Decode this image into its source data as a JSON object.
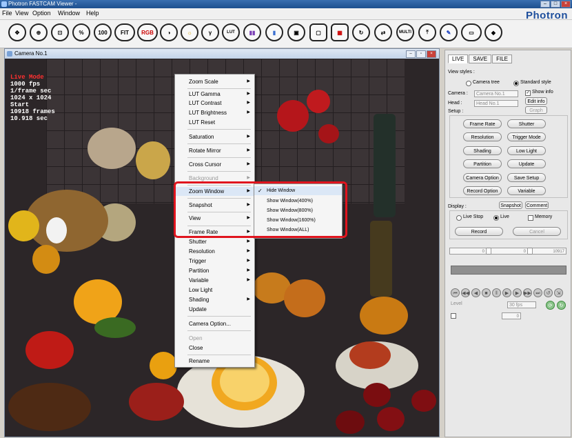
{
  "window": {
    "title": "Photron FASTCAM Viewer -"
  },
  "menubar": [
    "File",
    "View",
    "Option",
    "Window",
    "Help"
  ],
  "brand": "Photron",
  "toolbar": {
    "buttons": [
      {
        "name": "move-icon",
        "label": "✥"
      },
      {
        "name": "zoom-in-icon",
        "label": "⊕"
      },
      {
        "name": "crop-icon",
        "label": "⊡"
      },
      {
        "name": "percent-icon",
        "label": "%"
      },
      {
        "name": "zoom-100-icon",
        "label": "100"
      },
      {
        "name": "fit-icon",
        "label": "FIT"
      },
      {
        "name": "rgb-icon",
        "label": "RGB"
      },
      {
        "name": "contrast-icon",
        "label": "◑"
      },
      {
        "name": "brightness-icon",
        "label": "☼"
      },
      {
        "name": "gamma-icon",
        "label": "γ"
      },
      {
        "name": "lut-reset-icon",
        "label": "LUT"
      },
      {
        "name": "color-bars-icon",
        "label": "▮▮"
      },
      {
        "name": "color-reset-icon",
        "label": "▮"
      },
      {
        "name": "mask-icon",
        "label": "▣"
      },
      {
        "name": "window-icon",
        "label": "▢"
      },
      {
        "name": "grid-icon",
        "label": "▦"
      },
      {
        "name": "refresh-icon",
        "label": "↻"
      },
      {
        "name": "sync-icon",
        "label": "⇄"
      },
      {
        "name": "multi-lock-icon",
        "label": "MULTI"
      },
      {
        "name": "cursor-icon",
        "label": "⤒"
      },
      {
        "name": "pen-icon",
        "label": "✎"
      },
      {
        "name": "display-icon",
        "label": "▭"
      },
      {
        "name": "eraser-icon",
        "label": "◆"
      }
    ]
  },
  "camera": {
    "title": "Camera No.1",
    "info": {
      "mode": "Live Mode",
      "fps": "1000 fps",
      "shutter": "1/frame sec",
      "resolution": "1024 x 1024",
      "start": "Start",
      "frames": "10918 frames",
      "sec": "10.918 sec"
    }
  },
  "context_menu": {
    "items": [
      {
        "label": "Zoom Scale",
        "arrow": true
      },
      {
        "label": "LUT Gamma",
        "arrow": true
      },
      {
        "label": "LUT Contrast",
        "arrow": true
      },
      {
        "label": "LUT Brightness",
        "arrow": true
      },
      {
        "label": "LUT Reset",
        "arrow": false
      },
      {
        "label": "Saturation",
        "arrow": true
      },
      {
        "label": "Rotate Mirror",
        "arrow": true
      },
      {
        "label": "Cross Cursor",
        "arrow": true
      },
      {
        "label": "Background",
        "arrow": true,
        "disabled": true
      },
      {
        "label": "Zoom Window",
        "arrow": true,
        "highlighted": true
      },
      {
        "label": "Snapshot",
        "arrow": true
      },
      {
        "label": "View",
        "arrow": true
      },
      {
        "label": "Frame Rate",
        "arrow": true
      },
      {
        "label": "Shutter",
        "arrow": true
      },
      {
        "label": "Resolution",
        "arrow": true
      },
      {
        "label": "Trigger",
        "arrow": true
      },
      {
        "label": "Partition",
        "arrow": true
      },
      {
        "label": "Variable",
        "arrow": true
      },
      {
        "label": "Low Light",
        "arrow": false
      },
      {
        "label": "Shading",
        "arrow": true
      },
      {
        "label": "Update",
        "arrow": false
      },
      {
        "label": "Camera Option...",
        "arrow": false
      },
      {
        "label": "Open",
        "arrow": false,
        "disabled": true
      },
      {
        "label": "Close",
        "arrow": false
      },
      {
        "label": "Rename",
        "arrow": false
      }
    ]
  },
  "submenu": {
    "items": [
      {
        "label": "Hide Window",
        "checked": true
      },
      {
        "label": "Show Window(400%)",
        "checked": false
      },
      {
        "label": "Show Window(800%)",
        "checked": false
      },
      {
        "label": "Show Window(1600%)",
        "checked": false
      },
      {
        "label": "Show Window(ALL)",
        "checked": false
      }
    ]
  },
  "panel": {
    "tabs": [
      "LIVE",
      "SAVE",
      "FILE"
    ],
    "view_styles_label": "View styles :",
    "camera_tree": "Camera tree",
    "standard_style": "Standard style",
    "camera_label": "Camera :",
    "camera_value": "Camera No.1",
    "head_label": "Head :",
    "head_value": "Head No.1",
    "show_info": "Show info",
    "edit_info": "Edit info",
    "graph": "Graph",
    "setup_label": "Setup :",
    "setup_buttons": [
      "Frame Rate",
      "Shutter",
      "Resolution",
      "Trigger Mode",
      "Shading",
      "Low Light",
      "Partition",
      "Update",
      "Camera Option",
      "Save Setup",
      "Record Option",
      "Variable"
    ],
    "display_label": "Display :",
    "snapshot": "Snapshot",
    "comment": "Comment",
    "live_stop": "Live Stop",
    "live": "Live",
    "memory": "Memory",
    "record": "Record",
    "cancel": "Cancel",
    "slider_left": "0",
    "slider_mid": "0",
    "slider_right": "10917",
    "fps_combo": "30 fps",
    "frame_num": "0",
    "level": "Level",
    "accent": "#e0141e"
  }
}
